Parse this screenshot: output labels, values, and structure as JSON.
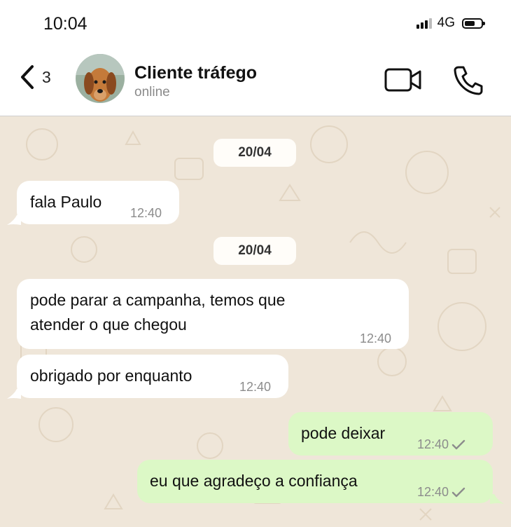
{
  "status_bar": {
    "time": "10:04",
    "network": "4G"
  },
  "header": {
    "back_count": "3",
    "contact_name": "Cliente tráfego",
    "contact_status": "online"
  },
  "chat": {
    "dates": [
      "20/04",
      "20/04"
    ],
    "messages": [
      {
        "direction": "incoming",
        "text_lines": [
          "fala Paulo"
        ],
        "time": "12:40"
      },
      {
        "direction": "incoming",
        "text_lines": [
          "pode parar a campanha, temos que",
          "atender o que chegou"
        ],
        "time": "12:40"
      },
      {
        "direction": "incoming",
        "text_lines": [
          "obrigado por enquanto"
        ],
        "time": "12:40"
      },
      {
        "direction": "outgoing",
        "text_lines": [
          "pode deixar"
        ],
        "time": "12:40",
        "status": "sent"
      },
      {
        "direction": "outgoing",
        "text_lines": [
          "eu que agradeço a confiança"
        ],
        "time": "12:40",
        "status": "sent"
      }
    ]
  },
  "colors": {
    "chat_background": "#efe6d9",
    "incoming_bubble": "#ffffff",
    "outgoing_bubble": "#dcf8c6",
    "timestamp": "#8c8c8c"
  },
  "icons": [
    "back-chevron-icon",
    "video-call-icon",
    "phone-call-icon",
    "single-check-icon",
    "signal-icon",
    "battery-icon"
  ]
}
